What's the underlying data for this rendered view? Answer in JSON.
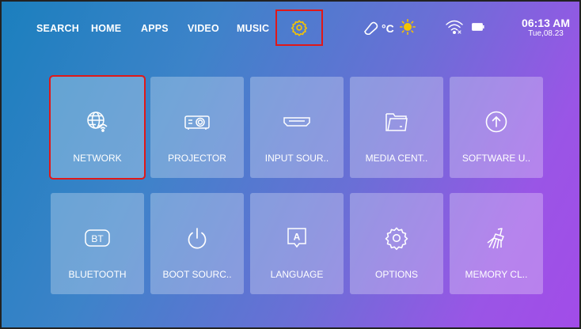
{
  "nav": {
    "items": [
      {
        "label": "SEARCH"
      },
      {
        "label": "HOME"
      },
      {
        "label": "APPS"
      },
      {
        "label": "VIDEO"
      },
      {
        "label": "MUSIC"
      }
    ],
    "settings_icon": "gear-icon"
  },
  "status": {
    "temperature": "°C",
    "weather_icon": "sun-icon",
    "wifi_icon": "wifi-disconnected-icon",
    "battery_icon": "battery-icon"
  },
  "clock": {
    "time": "06:13 AM",
    "date": "Tue,08.23"
  },
  "tiles": [
    {
      "label": "NETWORK",
      "icon": "network-globe-icon",
      "focused": true
    },
    {
      "label": "PROJECTOR",
      "icon": "projector-icon"
    },
    {
      "label": "INPUT SOUR..",
      "icon": "hdmi-icon"
    },
    {
      "label": "MEDIA CENT..",
      "icon": "folder-icon"
    },
    {
      "label": "SOFTWARE U..",
      "icon": "upload-arrow-icon"
    },
    {
      "label": "BLUETOOTH",
      "icon": "bluetooth-bt-icon"
    },
    {
      "label": "BOOT SOURC..",
      "icon": "power-icon"
    },
    {
      "label": "LANGUAGE",
      "icon": "language-icon",
      "icon_text": "A"
    },
    {
      "label": "OPTIONS",
      "icon": "gear-icon"
    },
    {
      "label": "MEMORY CL..",
      "icon": "broom-icon"
    }
  ],
  "colors": {
    "focus": "#e01818",
    "settings_icon": "#f5c400",
    "sun": "#f5c400"
  }
}
